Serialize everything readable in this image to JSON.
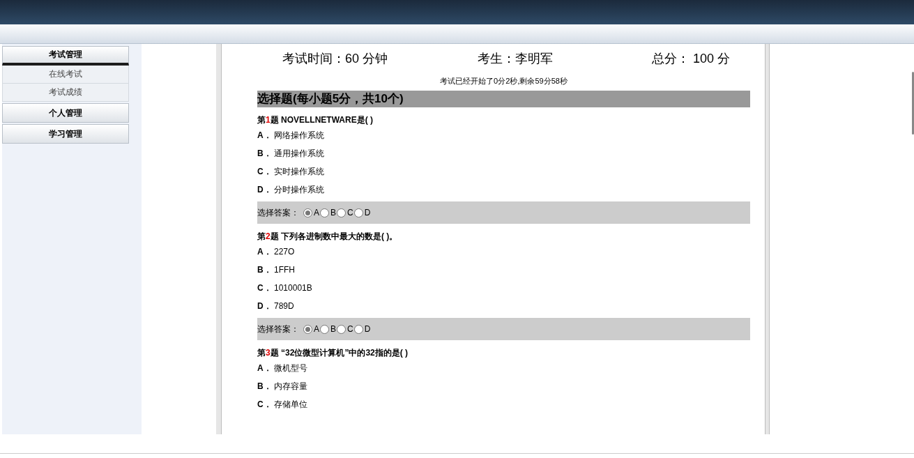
{
  "sidebar": {
    "groups": [
      {
        "title": "考试管理",
        "expanded": true,
        "items": [
          {
            "label": "在线考试"
          },
          {
            "label": "考试成绩"
          }
        ]
      },
      {
        "title": "个人管理",
        "expanded": false
      },
      {
        "title": "学习管理",
        "expanded": false
      }
    ]
  },
  "exam": {
    "time": "考试时间：60 分钟",
    "student": "考生：李明军",
    "total": "总分： 100 分",
    "timer": "考试已经开始了0分2秒,剩余59分58秒",
    "section": "选择题(每小题5分，共10个)",
    "questions": [
      {
        "prefix": "第",
        "number": "1",
        "suffix": "题",
        "text": "NOVELLNETWARE是( )",
        "options": [
          {
            "letter": "A．",
            "text": "网络操作系统"
          },
          {
            "letter": "B．",
            "text": "通用操作系统"
          },
          {
            "letter": "C．",
            "text": "实时操作系统"
          },
          {
            "letter": "D．",
            "text": "分时操作系统"
          }
        ],
        "answer_label": "选择答案：",
        "choices": [
          {
            "label": "A",
            "selected": true
          },
          {
            "label": "B",
            "selected": false
          },
          {
            "label": "C",
            "selected": false
          },
          {
            "label": "D",
            "selected": false
          }
        ]
      },
      {
        "prefix": "第",
        "number": "2",
        "suffix": "题",
        "text": "下列各进制数中最大的数是( )。",
        "options": [
          {
            "letter": "A．",
            "text": "227O"
          },
          {
            "letter": "B．",
            "text": "1FFH"
          },
          {
            "letter": "C．",
            "text": "1010001B"
          },
          {
            "letter": "D．",
            "text": "789D"
          }
        ],
        "answer_label": "选择答案：",
        "choices": [
          {
            "label": "A",
            "selected": true
          },
          {
            "label": "B",
            "selected": false
          },
          {
            "label": "C",
            "selected": false
          },
          {
            "label": "D",
            "selected": false
          }
        ]
      },
      {
        "prefix": "第",
        "number": "3",
        "suffix": "题",
        "text": "“32位微型计算机”中的32指的是( )",
        "options": [
          {
            "letter": "A．",
            "text": "微机型号"
          },
          {
            "letter": "B．",
            "text": "内存容量"
          },
          {
            "letter": "C．",
            "text": "存储单位"
          }
        ]
      }
    ]
  }
}
